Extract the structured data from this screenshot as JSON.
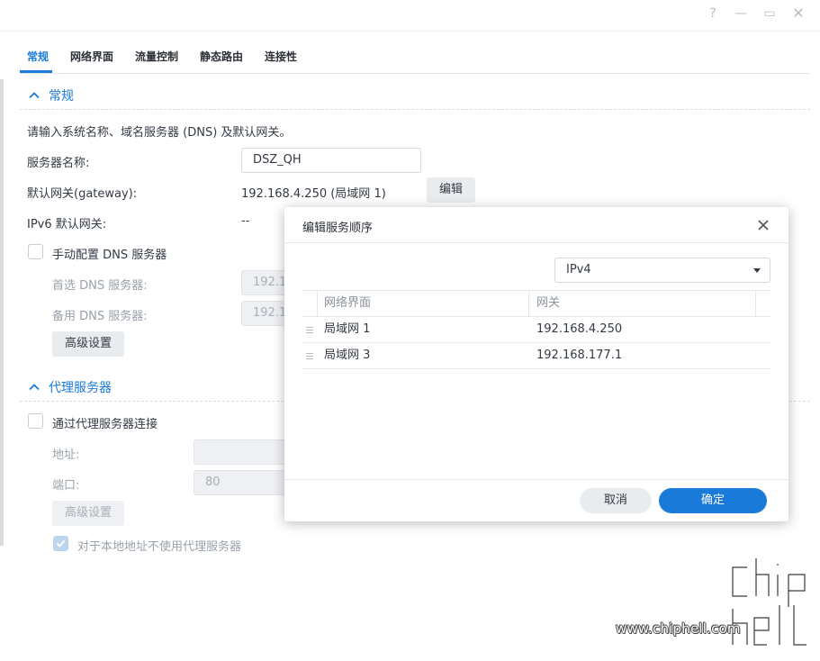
{
  "window": {
    "help_glyph": "?",
    "min_glyph": "—",
    "max_glyph": "▭",
    "close_glyph": "✕"
  },
  "tabs": [
    "常规",
    "网络界面",
    "流量控制",
    "静态路由",
    "连接性"
  ],
  "general": {
    "section_title": "常规",
    "description": "请输入系统名称、域名服务器 (DNS) 及默认网关。",
    "server_name_label": "服务器名称:",
    "server_name_value": "DSZ_QH",
    "gateway_label": "默认网关(gateway):",
    "gateway_value": "192.168.4.250 (局域网 1)",
    "edit_button": "编辑",
    "ipv6_gateway_label": "IPv6 默认网关:",
    "ipv6_gateway_value": "--",
    "manual_dns_label": "手动配置 DNS 服务器",
    "primary_dns_label": "首选 DNS 服务器:",
    "primary_dns_value": "192.1",
    "secondary_dns_label": "备用 DNS 服务器:",
    "secondary_dns_value": "192.1",
    "advanced_button": "高级设置"
  },
  "proxy": {
    "section_title": "代理服务器",
    "connect_label": "通过代理服务器连接",
    "address_label": "地址:",
    "address_value": "",
    "port_label": "端口:",
    "port_value": "80",
    "advanced_button": "高级设置",
    "bypass_local_label": "对于本地地址不使用代理服务器"
  },
  "modal": {
    "title": "编辑服务顺序",
    "protocol_selected": "IPv4",
    "columns": [
      "网络界面",
      "网关"
    ],
    "rows": [
      {
        "interface": "局域网 1",
        "gateway": "192.168.4.250"
      },
      {
        "interface": "局域网 3",
        "gateway": "192.168.177.1"
      }
    ],
    "cancel_button": "取消",
    "ok_button": "确定"
  },
  "watermark": {
    "site": "www.chiphell.com"
  },
  "colors": {
    "accent": "#1a7ad9",
    "text": "#333a44",
    "muted": "#9aa2ab"
  }
}
